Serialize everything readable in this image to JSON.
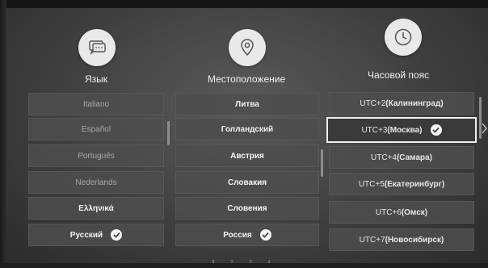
{
  "language": {
    "title": "Язык",
    "icon": "chat-bubble-icon",
    "items": [
      "Italiano",
      "Español",
      "Português",
      "Nederlands",
      "Ελληνικά",
      "Русский"
    ]
  },
  "location": {
    "title": "Местоположение",
    "icon": "location-pin-icon",
    "items": [
      "Литва",
      "Голландский",
      "Австрия",
      "Словакия",
      "Словения",
      "Россия"
    ]
  },
  "timezone": {
    "title": "Часовой пояс",
    "icon": "clock-icon",
    "items": [
      {
        "offset": "UTC+2 ",
        "city": "(Калининград)"
      },
      {
        "offset": "UTC+3 ",
        "city": "(Москва)"
      },
      {
        "offset": "UTC+4 ",
        "city": "(Самара)"
      },
      {
        "offset": "UTC+5 ",
        "city": "(Екатеринбург)"
      },
      {
        "offset": "UTC+6 ",
        "city": "(Омск)"
      },
      {
        "offset": "UTC+7 ",
        "city": "(Новосибирск)"
      }
    ]
  },
  "pagination": [
    "1",
    "2",
    "3",
    "4"
  ],
  "colors": {
    "accent": "#ffffff",
    "item_bg": "#4e4e4e",
    "background": "#464646"
  }
}
